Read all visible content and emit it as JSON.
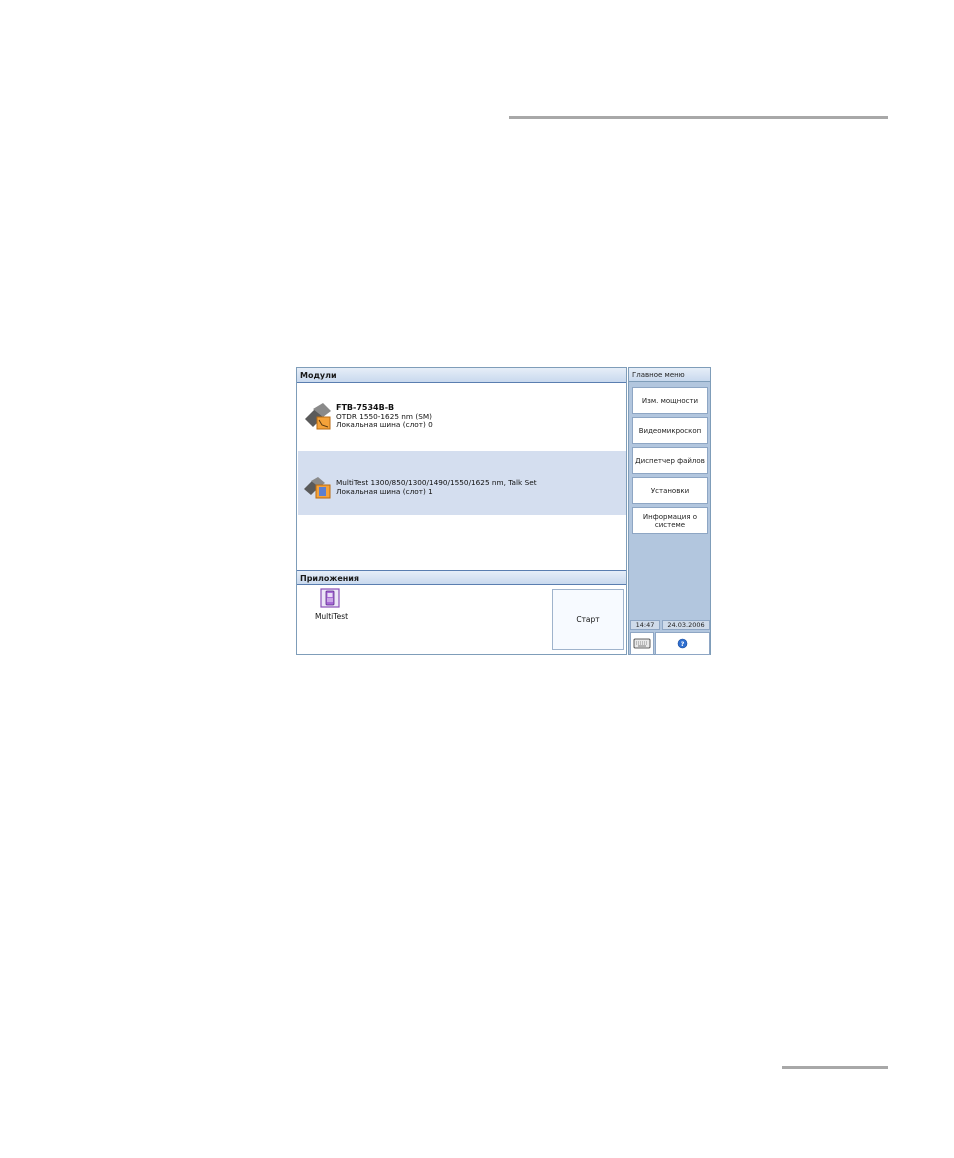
{
  "modules": {
    "header": "Модули",
    "items": [
      {
        "name": "FTB-7534B-B",
        "detail": "OTDR 1550-1625 nm (SM)",
        "slot": "Локальная шина (слот) 0"
      },
      {
        "name": "MultiTest 1300/850/1300/1490/1550/1625 nm, Talk Set",
        "slot": "Локальная шина (слот) 1"
      }
    ]
  },
  "applications": {
    "header": "Приложения",
    "items": [
      {
        "label": "MultiTest",
        "icon": "multitest-icon"
      }
    ],
    "start_label": "Старт"
  },
  "main_menu": {
    "title": "Главное меню",
    "buttons": [
      "Изм. мощности",
      "Видеомикроскоп",
      "Диспетчер файлов",
      "Установки",
      "Информация о системе"
    ]
  },
  "status": {
    "time": "14:47",
    "date": "24.03.2006"
  },
  "icons": {
    "keyboard": "keyboard-icon",
    "help": "help-icon"
  },
  "colors": {
    "selected_row": "#d4deef",
    "menu_panel": "#b2c6de",
    "header_border": "#5a7eb0"
  }
}
